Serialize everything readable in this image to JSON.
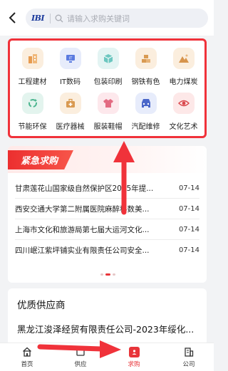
{
  "header": {
    "logo_text": "IBI",
    "search_placeholder": "请输入求购关键词"
  },
  "categories": [
    {
      "label": "工程建材",
      "icon": "building-icon",
      "bg": "#fbeede",
      "color": "#e79b50"
    },
    {
      "label": "IT数码",
      "icon": "monitor-icon",
      "bg": "#e7ecfb",
      "color": "#5b7be0"
    },
    {
      "label": "包装印刷",
      "icon": "package-icon",
      "bg": "#e3f4f3",
      "color": "#4fb6ae"
    },
    {
      "label": "钢铁有色",
      "icon": "steel-bars-icon",
      "bg": "#fbeede",
      "color": "#d99a52"
    },
    {
      "label": "电力煤炭",
      "icon": "mountain-icon",
      "bg": "#fbeede",
      "color": "#d7944c"
    },
    {
      "label": "节能环保",
      "icon": "recycle-icon",
      "bg": "#e3f4ee",
      "color": "#4cb58f"
    },
    {
      "label": "医疗器械",
      "icon": "medical-kit-icon",
      "bg": "#fbeede",
      "color": "#d99a52"
    },
    {
      "label": "服装鞋帽",
      "icon": "tshirt-icon",
      "bg": "#fde8ec",
      "color": "#e36b82"
    },
    {
      "label": "汽配维修",
      "icon": "car-repair-icon",
      "bg": "#e7ecfb",
      "color": "#4a66c9"
    },
    {
      "label": "文化艺术",
      "icon": "eye-icon",
      "bg": "#fde8e8",
      "color": "#d9464b"
    }
  ],
  "urgent": {
    "title": "紧急求购",
    "items": [
      {
        "title": "甘肃莲花山国家级自然保护区2025年提...",
        "date": "07-14"
      },
      {
        "title": "西安交通大学第二附属医院麻醉科数美...",
        "date": "07-14"
      },
      {
        "title": "上海市文化和旅游局第七届大运河文化...",
        "date": "07-14"
      },
      {
        "title": "四川岷江紫坪铺实业有限责任公司安全...",
        "date": "07-14"
      }
    ]
  },
  "suppliers": {
    "title": "优质供应商",
    "first_item": "黑龙江浚泽经贸有限责任公司-2023年绥化..."
  },
  "tabbar": [
    {
      "label": "首页",
      "icon": "home-icon",
      "active": false
    },
    {
      "label": "供应",
      "icon": "supply-icon",
      "active": false
    },
    {
      "label": "求购",
      "icon": "purchase-icon",
      "active": true
    },
    {
      "label": "公司",
      "icon": "company-icon",
      "active": false
    }
  ],
  "colors": {
    "accent": "#e8353a",
    "annotation_red": "#f0323a"
  }
}
